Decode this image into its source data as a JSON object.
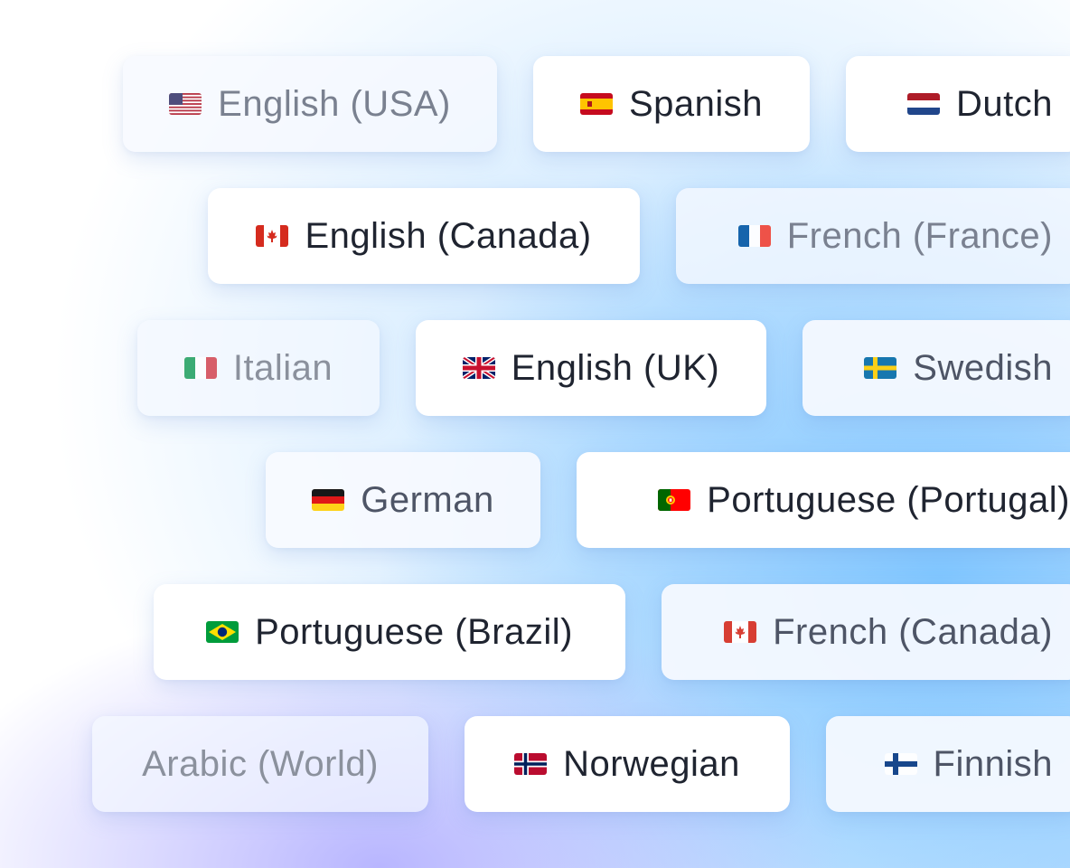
{
  "languages": [
    {
      "label": "English (USA)",
      "flag": "us-flag-icon"
    },
    {
      "label": "Spanish",
      "flag": "es-flag-icon"
    },
    {
      "label": "Dutch",
      "flag": "nl-flag-icon"
    },
    {
      "label": "English (Canada)",
      "flag": "ca-flag-icon"
    },
    {
      "label": "French (France)",
      "flag": "fr-flag-icon"
    },
    {
      "label": "Italian",
      "flag": "it-flag-icon"
    },
    {
      "label": "English (UK)",
      "flag": "gb-flag-icon"
    },
    {
      "label": "Swedish",
      "flag": "se-flag-icon"
    },
    {
      "label": "German",
      "flag": "de-flag-icon"
    },
    {
      "label": "Portuguese (Portugal)",
      "flag": "pt-flag-icon"
    },
    {
      "label": "Portuguese (Brazil)",
      "flag": "br-flag-icon"
    },
    {
      "label": "French (Canada)",
      "flag": "ca-flag-icon"
    },
    {
      "label": "Arabic (World)",
      "flag": null
    },
    {
      "label": "Norwegian",
      "flag": "no-flag-icon"
    },
    {
      "label": "Finnish",
      "flag": "fi-flag-icon"
    }
  ],
  "colors": {
    "chip_background": "#ffffff",
    "text_primary": "#1f2430",
    "text_muted": "#7a8190",
    "glow_blue": "#7dc5ff",
    "glow_violet": "#b5b2ff"
  }
}
